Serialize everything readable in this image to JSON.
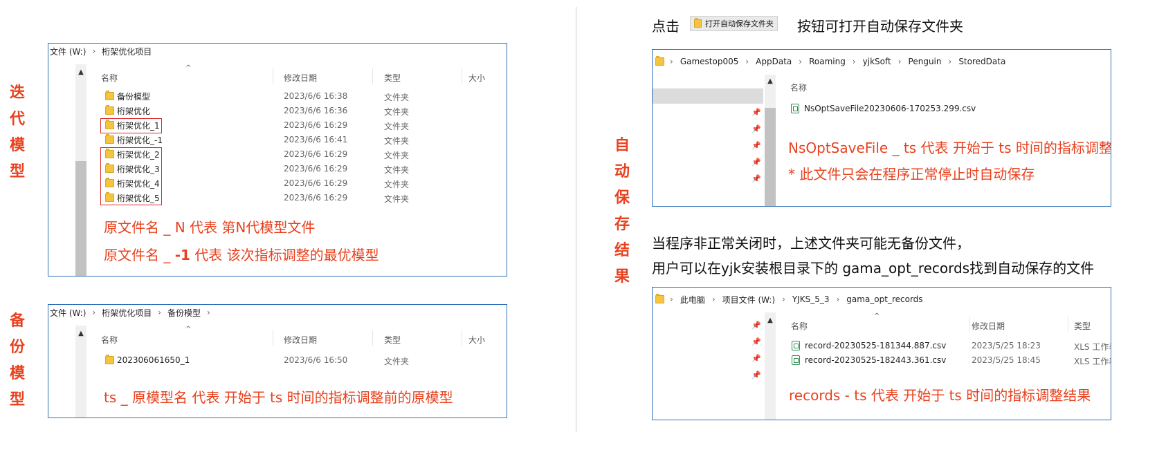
{
  "left": {
    "label_iter": [
      "迭",
      "代",
      "模",
      "型"
    ],
    "label_backup": [
      "备",
      "份",
      "模",
      "型"
    ],
    "panel1": {
      "path": [
        "文件 (W:)",
        "桁架优化项目"
      ],
      "headers": {
        "name": "名称",
        "date": "修改日期",
        "type": "类型",
        "size": "大小"
      },
      "rows": [
        {
          "name": "备份模型",
          "date": "2023/6/6 16:38",
          "type": "文件夹"
        },
        {
          "name": "桁架优化",
          "date": "2023/6/6 16:36",
          "type": "文件夹"
        },
        {
          "name": "桁架优化_1",
          "date": "2023/6/6 16:29",
          "type": "文件夹"
        },
        {
          "name": "桁架优化_-1",
          "date": "2023/6/6 16:41",
          "type": "文件夹"
        },
        {
          "name": "桁架优化_2",
          "date": "2023/6/6 16:29",
          "type": "文件夹"
        },
        {
          "name": "桁架优化_3",
          "date": "2023/6/6 16:29",
          "type": "文件夹"
        },
        {
          "name": "桁架优化_4",
          "date": "2023/6/6 16:29",
          "type": "文件夹"
        },
        {
          "name": "桁架优化_5",
          "date": "2023/6/6 16:29",
          "type": "文件夹"
        }
      ],
      "note1": "原文件名 _ N  代表 第N代模型文件",
      "note2_a": "原文件名 _ ",
      "note2_b": "-1",
      "note2_c": "  代表 该次指标调整的最优模型"
    },
    "panel2": {
      "path": [
        "文件 (W:)",
        "桁架优化项目",
        "备份模型"
      ],
      "headers": {
        "name": "名称",
        "date": "修改日期",
        "type": "类型",
        "size": "大小"
      },
      "rows": [
        {
          "name": "202306061650_1",
          "date": "2023/6/6 16:50",
          "type": "文件夹"
        }
      ],
      "note": "ts _ 原模型名  代表  开始于 ts 时间的指标调整前的原模型"
    }
  },
  "right": {
    "label_auto": [
      "自",
      "动",
      "保",
      "存",
      "结",
      "果"
    ],
    "intro_a": "点击",
    "intro_button": "打开自动保存文件夹",
    "intro_b": "按钮可打开自动保存文件夹",
    "panel3": {
      "path": [
        "Gamestop005",
        "AppData",
        "Roaming",
        "yjkSoft",
        "Penguin",
        "StoredData"
      ],
      "header_name": "名称",
      "file": "NsOptSaveFile20230606-170253.299.csv",
      "note1": "NsOptSaveFile _  ts 代表 开始于 ts 时间的指标调整结果",
      "note2": "* 此文件只会在程序正常停止时自动保存"
    },
    "para1": "当程序非正常关闭时，上述文件夹可能无备份文件，",
    "para2": "用户可以在yjk安装根目录下的 gama_opt_records找到自动保存的文件",
    "panel4": {
      "path": [
        "此电脑",
        "项目文件 (W:)",
        "YJKS_5_3",
        "gama_opt_records"
      ],
      "headers": {
        "name": "名称",
        "date": "修改日期",
        "type": "类型"
      },
      "rows": [
        {
          "name": "record-20230525-181344.887.csv",
          "date": "2023/5/25 18:23",
          "type": "XLS 工作表"
        },
        {
          "name": "record-20230525-182443.361.csv",
          "date": "2023/5/25 18:45",
          "type": "XLS 工作表"
        }
      ],
      "note": "records - ts 代表  开始于 ts 时间的指标调整结果"
    }
  }
}
